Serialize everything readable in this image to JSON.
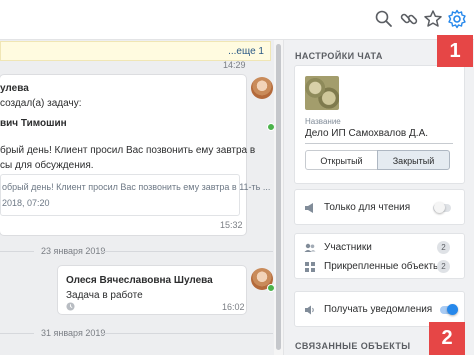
{
  "topbar": {
    "icons": [
      "search-icon",
      "link-icon",
      "star-icon",
      "gear-icon"
    ]
  },
  "chat": {
    "pinned_more": "...еще 1",
    "first_time": "14:29",
    "task_msg": {
      "author_fragment": "улева",
      "line1": "создал(а) задачу:",
      "assignee": "вич Тимошин",
      "line2": "брый день! Клиент просил Вас позвонить ему завтра в",
      "line3": "сы для обсуждения.",
      "quote_line1": "обрый день! Клиент просил Вас позвонить ему завтра в 11-ть ...",
      "quote_line2": "2018, 07:20",
      "time": "15:32"
    },
    "date_sep_1": "23 января 2019",
    "status_msg": {
      "author": "Олеся Вячеславовна Шулева",
      "text": "Задача в работе",
      "time": "16:02"
    },
    "date_sep_2": "31 января 2019"
  },
  "panel": {
    "settings_title": "НАСТРОЙКИ ЧАТА",
    "name_label": "Название",
    "name_value": "Дело ИП Самохвалов Д.А.",
    "open_button": "Открытый",
    "closed_button": "Закрытый",
    "selected_mode": "Закрытый",
    "read_only_label": "Только для чтения",
    "read_only_on": false,
    "participants_label": "Участники",
    "participants_count": "2",
    "attached_label": "Прикрепленные объекты",
    "attached_count": "2",
    "notifications_label": "Получать уведомления",
    "notifications_on": true,
    "related_title": "СВЯЗАННЫЕ ОБЪЕКТЫ"
  },
  "callouts": {
    "first": "1",
    "second": "2"
  },
  "colors": {
    "accent": "#2688eb",
    "callout": "#e64646",
    "online": "#4bb34b"
  }
}
